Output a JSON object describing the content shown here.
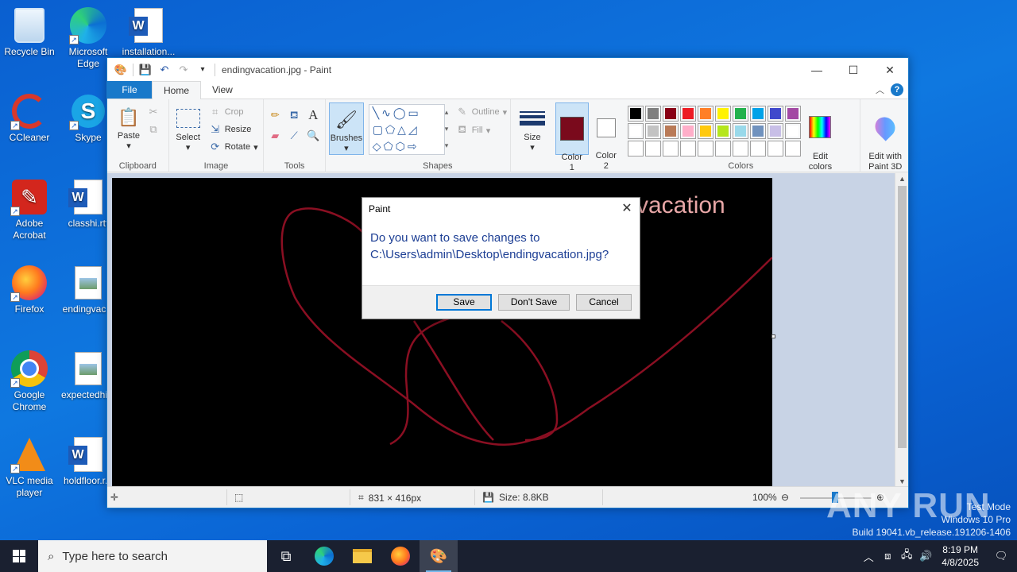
{
  "desktop": {
    "icons": [
      {
        "label": "Recycle Bin"
      },
      {
        "label": "Microsoft\nEdge"
      },
      {
        "label": "installation..."
      },
      {
        "label": "CCleaner"
      },
      {
        "label": "Skype"
      },
      {
        "label": "Adobe\nAcrobat"
      },
      {
        "label": "classhi.rtf"
      },
      {
        "label": "Firefox"
      },
      {
        "label": "endingvac..."
      },
      {
        "label": "Google\nChrome"
      },
      {
        "label": "expectedhi..."
      },
      {
        "label": "VLC media\nplayer"
      },
      {
        "label": "holdfloor.r..."
      }
    ]
  },
  "window": {
    "title": "endingvacation.jpg - Paint",
    "controls": {
      "minimize": "—",
      "maximize": "☐",
      "close": "✕"
    }
  },
  "ribbon": {
    "tabs": {
      "file": "File",
      "home": "Home",
      "view": "View"
    },
    "clipboard": {
      "paste": "Paste",
      "label": "Clipboard"
    },
    "image": {
      "select": "Select",
      "crop": "Crop",
      "resize": "Resize",
      "rotate": "Rotate",
      "label": "Image"
    },
    "tools": {
      "label": "Tools"
    },
    "brushes": {
      "label": "Brushes"
    },
    "shapes": {
      "outline": "Outline",
      "fill": "Fill",
      "label": "Shapes"
    },
    "size": {
      "label": "Size"
    },
    "color1": {
      "label": "Color\n1",
      "value": "#7a0a1c"
    },
    "color2": {
      "label": "Color\n2",
      "value": "#ffffff"
    },
    "colors": {
      "label": "Colors",
      "edit": "Edit\ncolors"
    },
    "paint3d": {
      "label": "Edit with\nPaint 3D"
    },
    "palette_row1": [
      "#000000",
      "#7f7f7f",
      "#880015",
      "#ed1c24",
      "#ff7f27",
      "#fff200",
      "#22b14c",
      "#00a2e8",
      "#3f48cc",
      "#a349a4"
    ],
    "palette_row2": [
      "#ffffff",
      "#c3c3c3",
      "#b97a57",
      "#ffaec9",
      "#ffc90e",
      "#b5e61d",
      "#99d9ea",
      "#7092be",
      "#c8bfe7",
      "#ffffff"
    ]
  },
  "canvas": {
    "overlay_text": "vacation"
  },
  "status": {
    "dimensions": "831 × 416px",
    "size": "Size: 8.8KB",
    "zoom": "100%"
  },
  "dialog": {
    "title": "Paint",
    "message": "Do you want to save changes to\nC:\\Users\\admin\\Desktop\\endingvacation.jpg?",
    "save": "Save",
    "dont_save": "Don't Save",
    "cancel": "Cancel"
  },
  "taskbar": {
    "search_placeholder": "Type here to search",
    "time": "8:19 PM",
    "date": "4/8/2025"
  },
  "watermark": {
    "line1": "Test Mode",
    "line2": "Windows 10 Pro",
    "line3": "Build 19041.vb_release.191206-1406",
    "brand": "ANY RUN"
  }
}
